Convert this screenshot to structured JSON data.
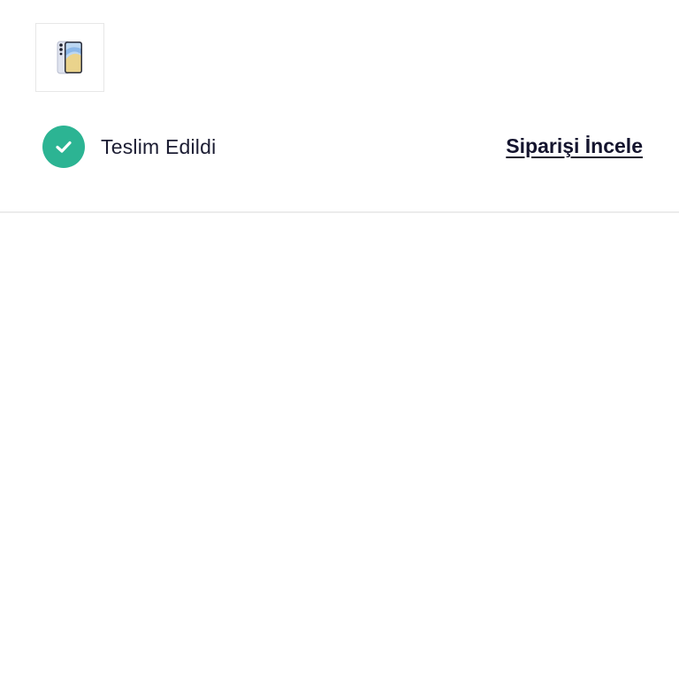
{
  "order": {
    "product_image": {
      "icon": "smartphone-icon",
      "alt": ""
    },
    "status": {
      "label": "Teslim Edildi",
      "icon": "check-circle-icon",
      "color": "#2cb493"
    },
    "review_link": {
      "label": "Siparişi İncele"
    }
  },
  "colors": {
    "text": "#1c1d33",
    "link": "#14142e",
    "divider": "#ececec",
    "status_green": "#2cb493"
  }
}
